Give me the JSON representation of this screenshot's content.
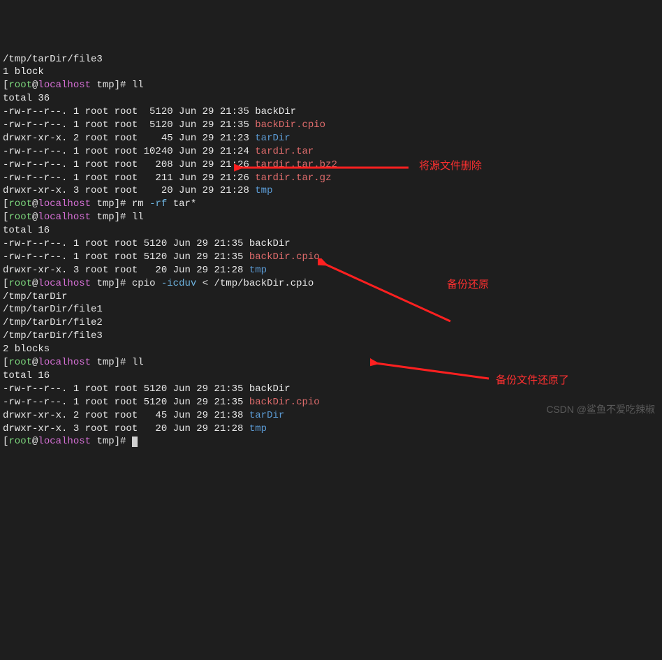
{
  "prompt": {
    "user": "root",
    "at": "@",
    "host": "localhost",
    "path": " tmp",
    "end": "]# "
  },
  "top_partial": {
    "path_line": "/tmp/tarDir/file3",
    "blocks": "1 block"
  },
  "cmd1": "ll",
  "ll1": {
    "total": "total 36",
    "rows": [
      {
        "perm": "-rw-r--r--.",
        "n": "1",
        "u": "root",
        "g": "root",
        "sz": " 5120",
        "date": "Jun 29 21:35",
        "name": "backDir",
        "cls": "white"
      },
      {
        "perm": "-rw-r--r--.",
        "n": "1",
        "u": "root",
        "g": "root",
        "sz": " 5120",
        "date": "Jun 29 21:35",
        "name": "backDir.cpio",
        "cls": "red"
      },
      {
        "perm": "drwxr-xr-x.",
        "n": "2",
        "u": "root",
        "g": "root",
        "sz": "   45",
        "date": "Jun 29 21:23",
        "name": "tarDir",
        "cls": "blue"
      },
      {
        "perm": "-rw-r--r--.",
        "n": "1",
        "u": "root",
        "g": "root",
        "sz": "10240",
        "date": "Jun 29 21:24",
        "name": "tardir.tar",
        "cls": "red"
      },
      {
        "perm": "-rw-r--r--.",
        "n": "1",
        "u": "root",
        "g": "root",
        "sz": "  208",
        "date": "Jun 29 21:26",
        "name": "tardir.tar.bz2",
        "cls": "red"
      },
      {
        "perm": "-rw-r--r--.",
        "n": "1",
        "u": "root",
        "g": "root",
        "sz": "  211",
        "date": "Jun 29 21:26",
        "name": "tardir.tar.gz",
        "cls": "red"
      },
      {
        "perm": "drwxr-xr-x.",
        "n": "3",
        "u": "root",
        "g": "root",
        "sz": "   20",
        "date": "Jun 29 21:28",
        "name": "tmp",
        "cls": "blue"
      }
    ]
  },
  "cmd2_pre": "rm ",
  "cmd2_flags": "-rf",
  "cmd2_post": " tar*",
  "cmd3": "ll",
  "ll2": {
    "total": "total 16",
    "rows": [
      {
        "perm": "-rw-r--r--.",
        "n": "1",
        "u": "root",
        "g": "root",
        "sz": "5120",
        "date": "Jun 29 21:35",
        "name": "backDir",
        "cls": "white"
      },
      {
        "perm": "-rw-r--r--.",
        "n": "1",
        "u": "root",
        "g": "root",
        "sz": "5120",
        "date": "Jun 29 21:35",
        "name": "backDir.cpio",
        "cls": "red"
      },
      {
        "perm": "drwxr-xr-x.",
        "n": "3",
        "u": "root",
        "g": "root",
        "sz": "  20",
        "date": "Jun 29 21:28",
        "name": "tmp",
        "cls": "blue"
      }
    ]
  },
  "cmd4_pre": "cpio ",
  "cmd4_flags": "-icduv",
  "cmd4_post": " < /tmp/backDir.cpio",
  "cpio_out": [
    "/tmp/tarDir",
    "/tmp/tarDir/file1",
    "/tmp/tarDir/file2",
    "/tmp/tarDir/file3",
    "2 blocks"
  ],
  "cmd5": "ll",
  "ll3": {
    "total": "total 16",
    "rows": [
      {
        "perm": "-rw-r--r--.",
        "n": "1",
        "u": "root",
        "g": "root",
        "sz": "5120",
        "date": "Jun 29 21:35",
        "name": "backDir",
        "cls": "white"
      },
      {
        "perm": "-rw-r--r--.",
        "n": "1",
        "u": "root",
        "g": "root",
        "sz": "5120",
        "date": "Jun 29 21:35",
        "name": "backDir.cpio",
        "cls": "red"
      },
      {
        "perm": "drwxr-xr-x.",
        "n": "2",
        "u": "root",
        "g": "root",
        "sz": "  45",
        "date": "Jun 29 21:38",
        "name": "tarDir",
        "cls": "blue"
      },
      {
        "perm": "drwxr-xr-x.",
        "n": "3",
        "u": "root",
        "g": "root",
        "sz": "  20",
        "date": "Jun 29 21:28",
        "name": "tmp",
        "cls": "blue"
      }
    ]
  },
  "annotations": {
    "a1": "将源文件删除",
    "a2": "备份还原",
    "a3": "备份文件还原了"
  },
  "watermark": "CSDN @鲨鱼不爱吃辣椒"
}
